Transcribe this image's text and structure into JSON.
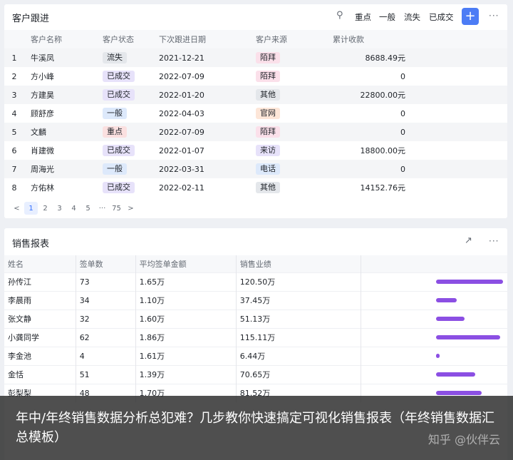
{
  "follow": {
    "title": "客户跟进",
    "filters": [
      "重点",
      "一般",
      "流失",
      "已成交"
    ],
    "add_label": "+",
    "more_label": "···",
    "columns": [
      "客户名称",
      "客户状态",
      "下次跟进日期",
      "客户来源",
      "累计收款"
    ],
    "rows": [
      {
        "idx": "1",
        "name": "牛溪凤",
        "status": "流失",
        "date": "2021-12-21",
        "source": "陌拜",
        "amount": "8688.49元"
      },
      {
        "idx": "2",
        "name": "方小峰",
        "status": "已成交",
        "date": "2022-07-09",
        "source": "陌拜",
        "amount": "0"
      },
      {
        "idx": "3",
        "name": "方建昊",
        "status": "已成交",
        "date": "2022-01-20",
        "source": "其他",
        "amount": "22800.00元"
      },
      {
        "idx": "4",
        "name": "顾舒彦",
        "status": "一般",
        "date": "2022-04-03",
        "source": "官网",
        "amount": "0"
      },
      {
        "idx": "5",
        "name": "文麟",
        "status": "重点",
        "date": "2022-07-09",
        "source": "陌拜",
        "amount": "0"
      },
      {
        "idx": "6",
        "name": "肖建微",
        "status": "已成交",
        "date": "2022-01-07",
        "source": "来访",
        "amount": "18800.00元"
      },
      {
        "idx": "7",
        "name": "周海光",
        "status": "一般",
        "date": "2022-03-31",
        "source": "电话",
        "amount": "0"
      },
      {
        "idx": "8",
        "name": "方佑林",
        "status": "已成交",
        "date": "2022-02-11",
        "source": "其他",
        "amount": "14152.76元"
      }
    ],
    "pager": [
      "<",
      "1",
      "2",
      "3",
      "4",
      "5",
      "···",
      "75",
      ">"
    ]
  },
  "status_colors": {
    "流失": {
      "bg": "#e4e7eb",
      "fg": "#1f2329"
    },
    "已成交": {
      "bg": "#e7e2fa",
      "fg": "#1f2329"
    },
    "一般": {
      "bg": "#dde9fb",
      "fg": "#1f2329"
    },
    "重点": {
      "bg": "#fbe0e0",
      "fg": "#1f2329"
    }
  },
  "source_colors": {
    "陌拜": {
      "bg": "#fbe0ea",
      "fg": "#1f2329"
    },
    "其他": {
      "bg": "#e4e7eb",
      "fg": "#1f2329"
    },
    "官网": {
      "bg": "#fde6d8",
      "fg": "#1f2329"
    },
    "来访": {
      "bg": "#e7e2fa",
      "fg": "#1f2329"
    },
    "电话": {
      "bg": "#dde9fb",
      "fg": "#1f2329"
    }
  },
  "sales": {
    "title": "销售报表",
    "expand_icon": "expand-icon",
    "more_label": "···",
    "columns": [
      "姓名",
      "签单数",
      "平均签单金额",
      "销售业绩"
    ],
    "rows": [
      {
        "name": "孙传江",
        "count": "73",
        "avg": "1.65万",
        "perf": "120.50万",
        "bar": 0.94
      },
      {
        "name": "李晨雨",
        "count": "34",
        "avg": "1.10万",
        "perf": "37.45万",
        "bar": 0.29
      },
      {
        "name": "张文静",
        "count": "32",
        "avg": "1.60万",
        "perf": "51.13万",
        "bar": 0.4
      },
      {
        "name": "小龚同学",
        "count": "62",
        "avg": "1.86万",
        "perf": "115.11万",
        "bar": 0.9
      },
      {
        "name": "李金池",
        "count": "4",
        "avg": "1.61万",
        "perf": "6.44万",
        "bar": 0.05
      },
      {
        "name": "金恬",
        "count": "51",
        "avg": "1.39万",
        "perf": "70.65万",
        "bar": 0.55
      },
      {
        "name": "彭梨梨",
        "count": "48",
        "avg": "1.70万",
        "perf": "81.52万",
        "bar": 0.64
      }
    ],
    "bar_color": "#8b4fe3"
  },
  "overlay": {
    "text": "年中/年终销售数据分析总犯难？几步教你快速搞定可视化销售报表（年终销售数据汇总模板）",
    "watermark": "知乎 @伙伴云"
  }
}
